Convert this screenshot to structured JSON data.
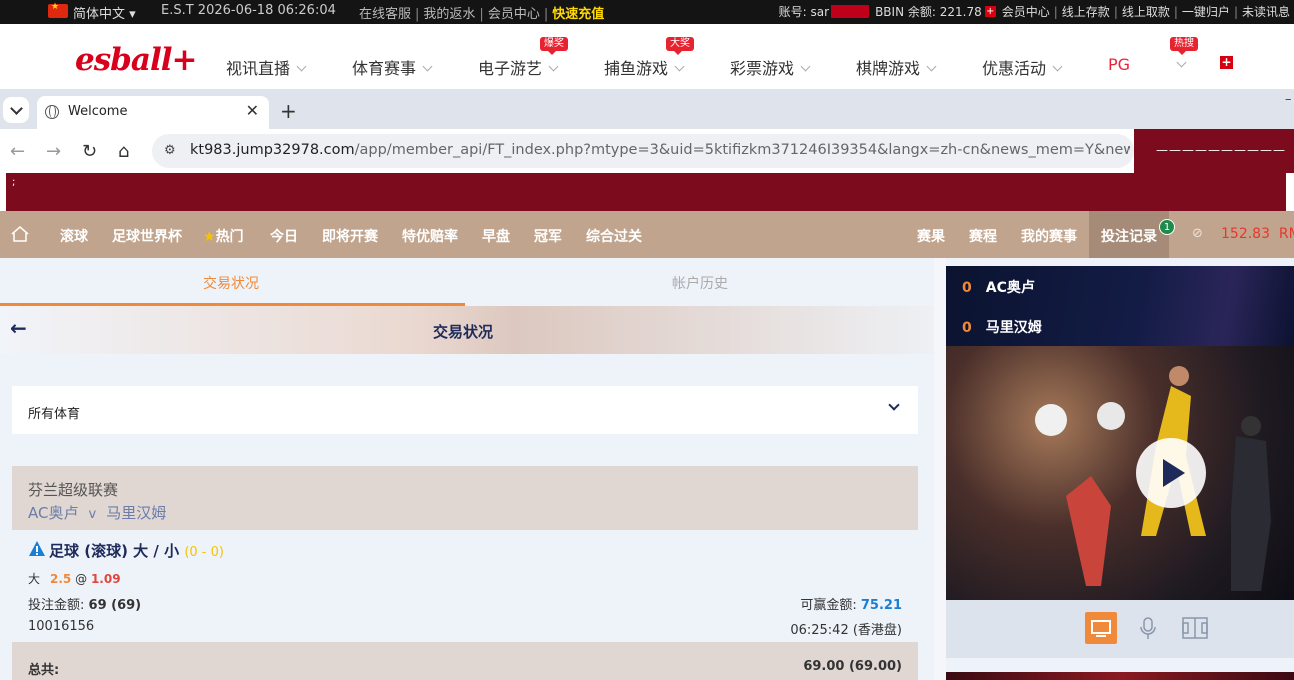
{
  "topbar": {
    "language": "简体中文 ▾",
    "clock": "E.S.T 2026-06-18 06:26:04",
    "links": [
      "在线客服",
      "我的返水",
      "会员中心"
    ],
    "recharge": "快速充值",
    "account_label": "账号: sar",
    "account_suffix": "",
    "bbin_balance": "BBIN 余额: 221.78",
    "account_links": [
      "会员中心",
      "线上存款",
      "线上取款",
      "一键归户",
      "未读讯息"
    ]
  },
  "nav": {
    "logo": "esball+",
    "items": [
      "视讯直播",
      "体育赛事",
      "电子游艺",
      "捕鱼游戏",
      "彩票游戏",
      "棋牌游戏",
      "优惠活动",
      "PG"
    ],
    "badges": {
      "slots": "爆奖",
      "fishing": "大奖",
      "hot": "热搜"
    }
  },
  "browser": {
    "tab_title": "Welcome",
    "url_host": "kt983.jump32978.com",
    "url_rest": "/app/member_api/FT_index.php?mtype=3&uid=5ktifizkm371246I39354&langx=zh-cn&news_mem=Y&news_api=Y...",
    "right_marquee": "——————————",
    "banner_text": ";"
  },
  "sportnav": {
    "items": [
      "滚球",
      "足球世界杯",
      "热门",
      "今日",
      "即将开赛",
      "特优赔率",
      "早盘",
      "冠军",
      "综合过关"
    ],
    "right_items": [
      "赛果",
      "赛程",
      "我的赛事",
      "投注记录"
    ],
    "bet_count": "1",
    "balance": "152.83",
    "currency": "RM"
  },
  "main": {
    "tabs": [
      "交易状况",
      "帐户历史"
    ],
    "header_title": "交易状况",
    "filter_label": "所有体育",
    "bet": {
      "league": "芬兰超级联赛",
      "home": "AC奥卢",
      "vs": "v",
      "away": "马里汉姆",
      "type": "足球 (滚球) 大 / 小",
      "score": "(0 - 0)",
      "selection": "大",
      "line": "2.5",
      "at": "@",
      "odds": "1.09",
      "stake_label": "投注金额:",
      "stake": "69 (69)",
      "win_label": "可赢金额:",
      "win": "75.21",
      "ticket_id": "10016156",
      "time": "06:25:42 (香港盘)"
    },
    "total_label": "总共:",
    "total_value": "69.00 (69.00)"
  },
  "live": {
    "home_score": "0",
    "home": "AC奥卢",
    "away_score": "0",
    "away": "马里汉姆"
  }
}
